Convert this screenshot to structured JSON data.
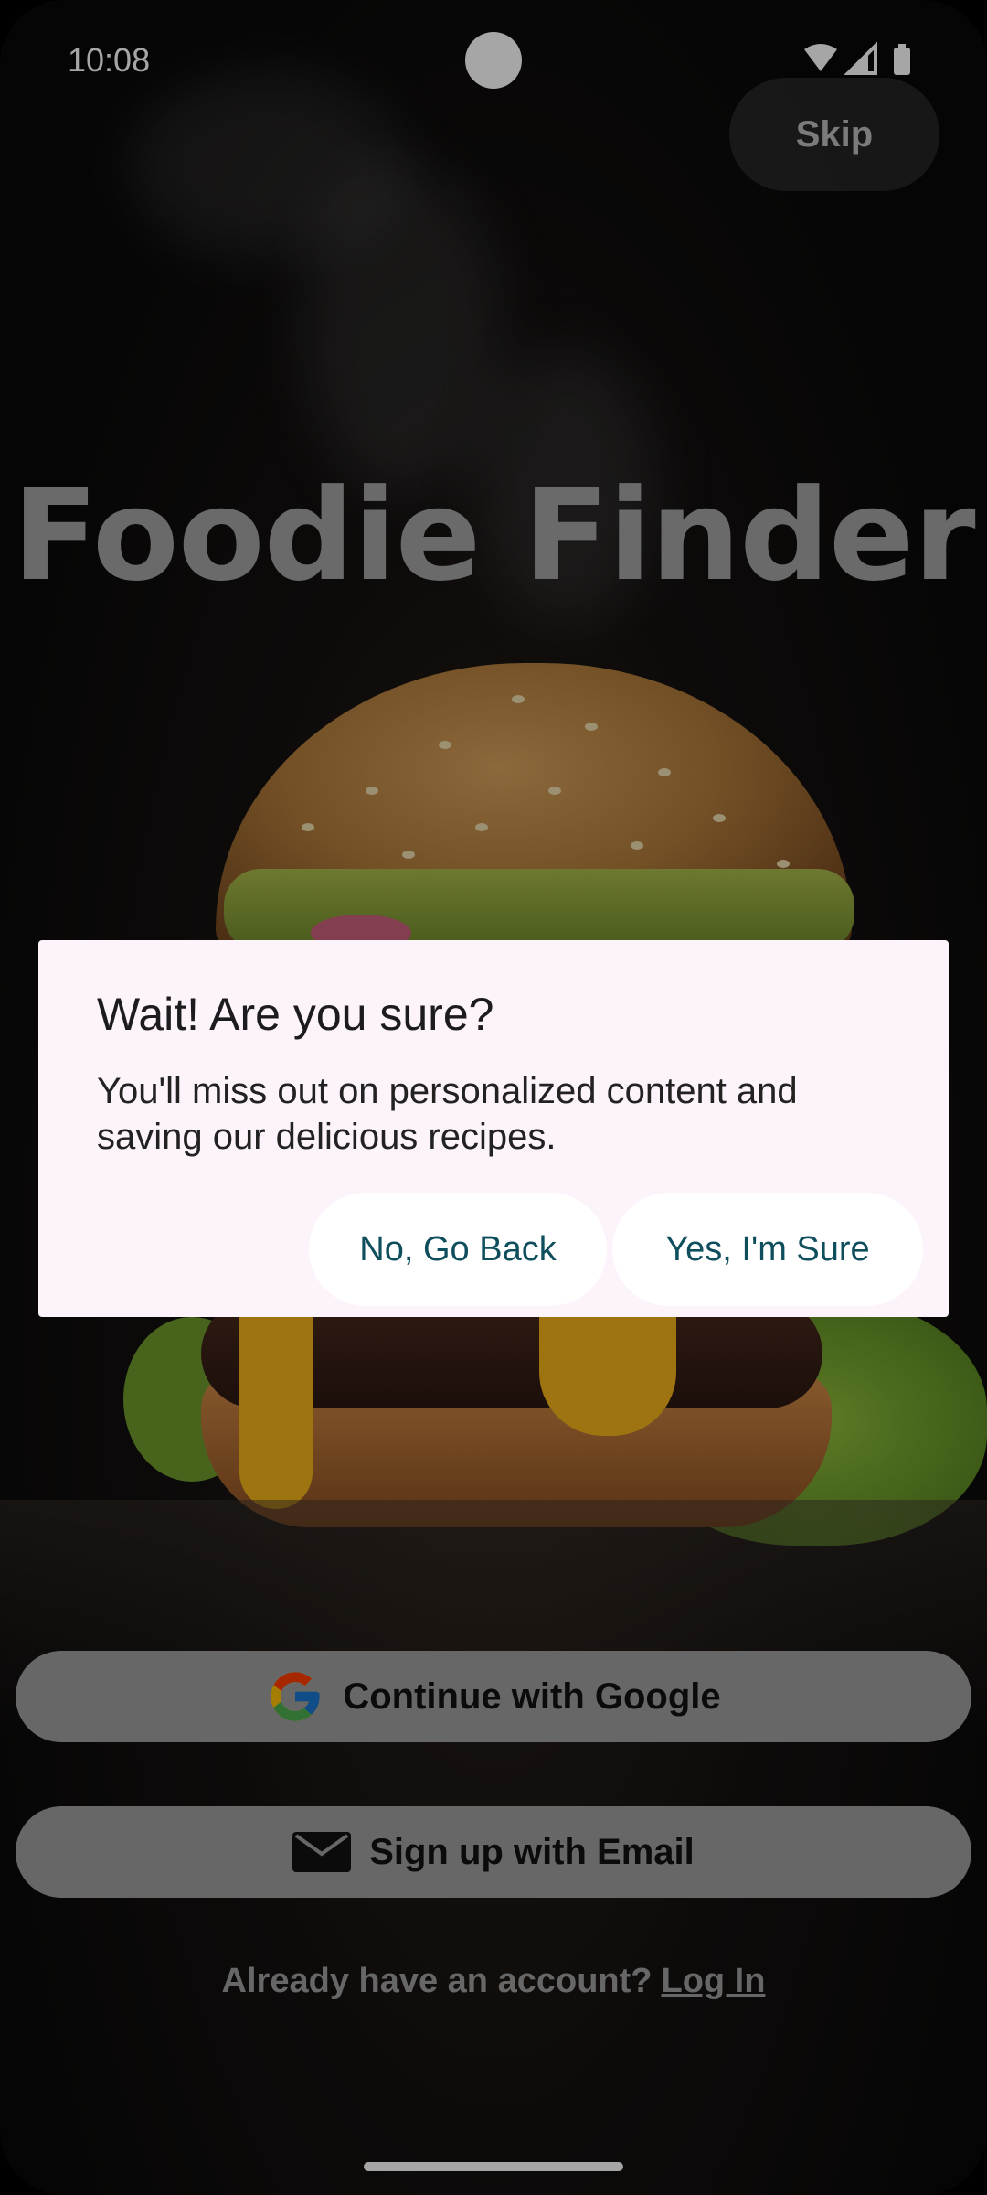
{
  "status_bar": {
    "time": "10:08"
  },
  "header": {
    "skip_label": "Skip"
  },
  "app": {
    "title": "Foodie Finder"
  },
  "dialog": {
    "title": "Wait! Are you sure?",
    "body": "You'll miss out on personalized content and saving our delicious recipes.",
    "cancel_label": "No, Go Back",
    "confirm_label": "Yes, I'm Sure"
  },
  "auth": {
    "google_label": "Continue with Google",
    "email_label": "Sign up with Email",
    "account_prompt": "Already have an account?",
    "login_label": "Log In"
  },
  "colors": {
    "dialog_background": "#fcf3fb",
    "dialog_button_text": "#0f4e5c",
    "pill_background": "#9e9e9e"
  }
}
